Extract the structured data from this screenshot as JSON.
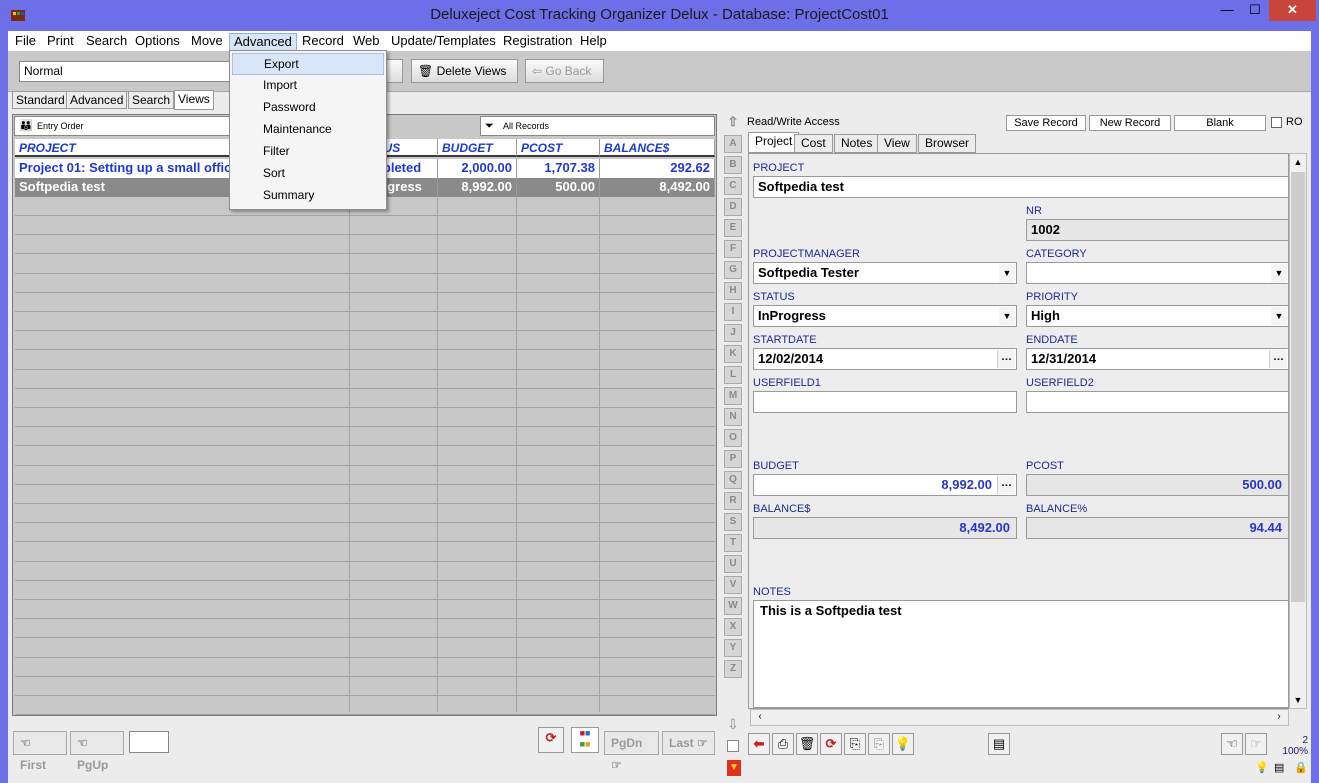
{
  "window": {
    "title": "Deluxeject Cost Tracking Organizer Delux - Database: ProjectCost01",
    "minimize": "—",
    "maximize": "☐",
    "close": "✕"
  },
  "menu": [
    "File",
    "Print",
    "Search",
    "Options",
    "Move",
    "Advanced",
    "Record",
    "Web",
    "Update/Templates",
    "Registration",
    "Help"
  ],
  "dropdown": [
    "Export",
    "Import",
    "Password",
    "Maintenance",
    "Filter",
    "Sort",
    "Summary"
  ],
  "toolbar": {
    "view_value": "Normal",
    "delete_views": "Delete Views",
    "go_back": "Go Back"
  },
  "left_tabs": [
    "Standard",
    "Advanced",
    "Search",
    "Views"
  ],
  "list": {
    "entry_order": "Entry Order",
    "all_records": "All Records",
    "columns": [
      "PROJECT",
      "STATUS",
      "BUDGET",
      "PCOST",
      "BALANCE$"
    ],
    "rows": [
      {
        "project": "Project 01: Setting up a small office",
        "status": "Completed",
        "budget": "2,000.00",
        "pcost": "1,707.38",
        "balance": "292.62"
      },
      {
        "project": "Softpedia test",
        "status": "InProgress",
        "budget": "8,992.00",
        "pcost": "500.00",
        "balance": "8,492.00"
      }
    ]
  },
  "nav": {
    "first": "First",
    "pgup": "PgUp",
    "pgdn": "PgDn",
    "last": "Last"
  },
  "alphabet": [
    "A",
    "B",
    "C",
    "D",
    "E",
    "F",
    "G",
    "H",
    "I",
    "J",
    "K",
    "L",
    "M",
    "N",
    "O",
    "P",
    "Q",
    "R",
    "S",
    "T",
    "U",
    "V",
    "W",
    "X",
    "Y",
    "Z"
  ],
  "right": {
    "access": "Read/Write Access",
    "save_record": "Save Record",
    "new_record": "New Record",
    "blank": "Blank",
    "ro": "RO",
    "tabs": [
      "Project",
      "Cost",
      "Notes",
      "View",
      "Browser"
    ]
  },
  "form": {
    "project_label": "PROJECT",
    "project": "Softpedia test",
    "nr_label": "NR",
    "nr": "1002",
    "pm_label": "PROJECTMANAGER",
    "pm": "Softpedia Tester",
    "category_label": "CATEGORY",
    "category": "",
    "status_label": "STATUS",
    "status": "InProgress",
    "priority_label": "PRIORITY",
    "priority": "High",
    "startdate_label": "STARTDATE",
    "startdate": "12/02/2014",
    "enddate_label": "ENDDATE",
    "enddate": "12/31/2014",
    "userfield1_label": "USERFIELD1",
    "userfield1": "",
    "userfield2_label": "USERFIELD2",
    "userfield2": "",
    "budget_label": "BUDGET",
    "budget": "8,992.00",
    "pcost_label": "PCOST",
    "pcost": "500.00",
    "balance_label": "BALANCE$",
    "balance": "8,492.00",
    "balancepct_label": "BALANCE%",
    "balancepct": "94.44",
    "notes_label": "NOTES",
    "notes": "This is a Softpedia test"
  },
  "status": {
    "count": "2",
    "zoom": "100%"
  },
  "colors": {
    "title_bar": "#6d6fe9",
    "close": "#c7453b",
    "link_blue": "#2238cc",
    "selected_row": "#8a8a8a"
  }
}
